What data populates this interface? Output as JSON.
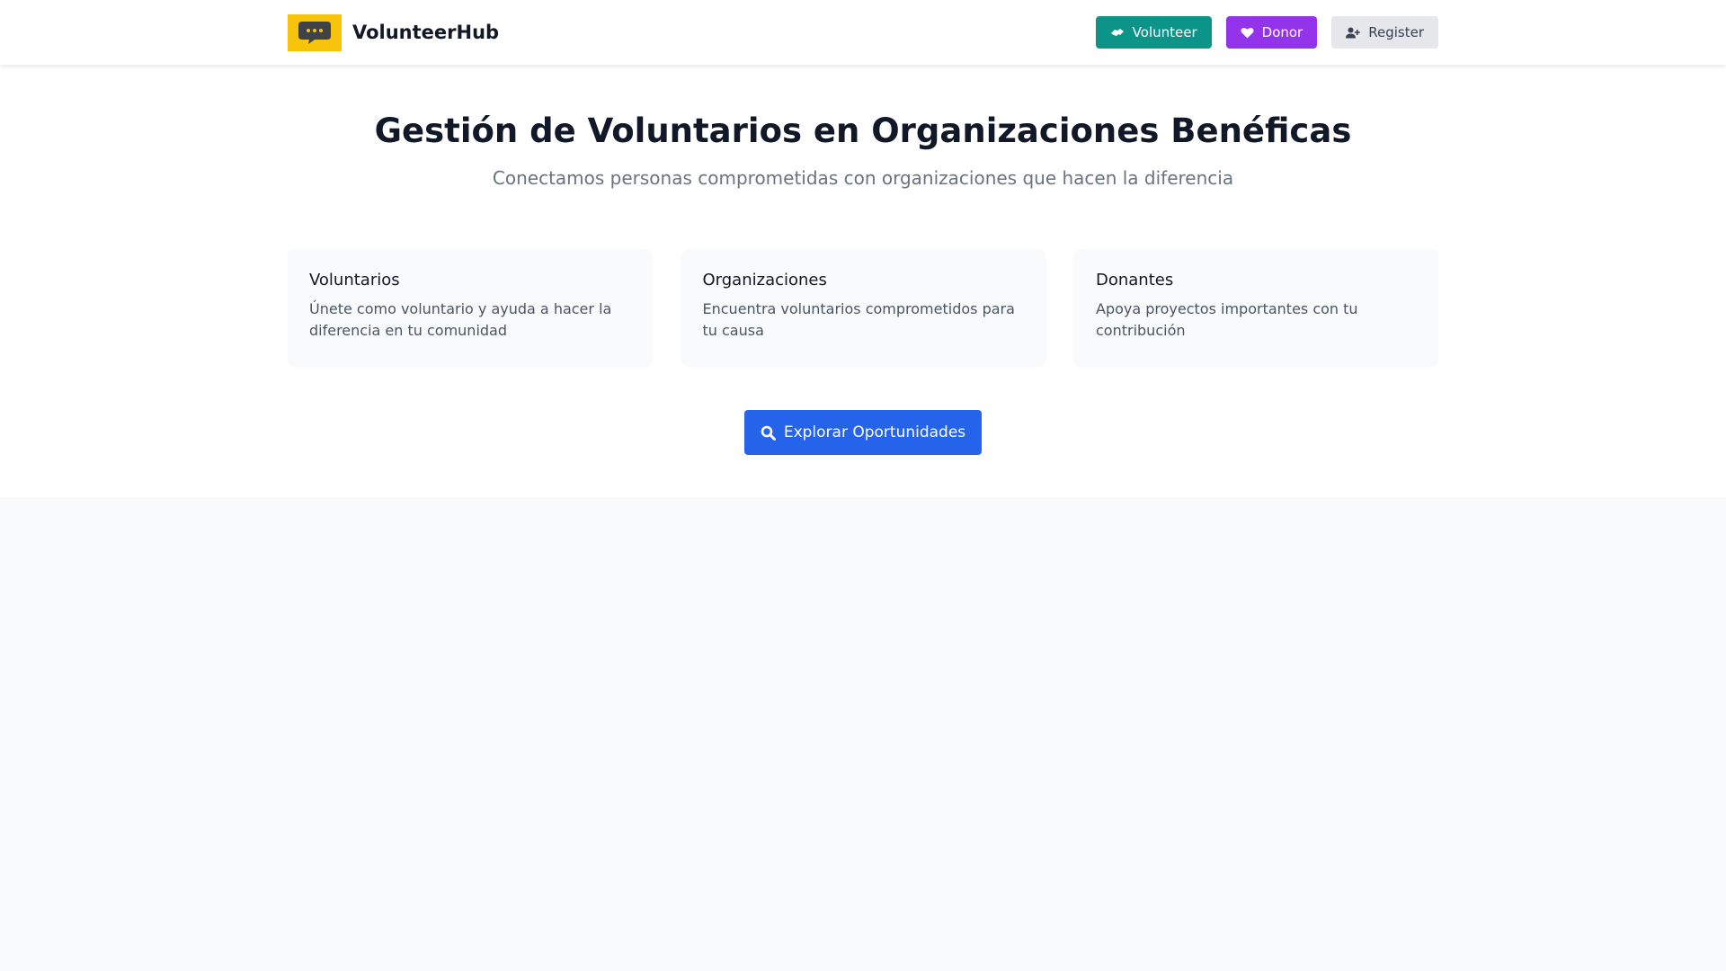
{
  "header": {
    "brand_name": "VolunteerHub",
    "logo_icon": "chat-bubble-icon",
    "nav": {
      "volunteer_label": "Volunteer",
      "donor_label": "Donor",
      "register_label": "Register"
    }
  },
  "hero": {
    "title": "Gestión de Voluntarios en Organizaciones Benéficas",
    "subtitle": "Conectamos personas comprometidas con organizaciones que hacen la diferencia",
    "cards": [
      {
        "title": "Voluntarios",
        "text": "Únete como voluntario y ayuda a hacer la diferencia en tu comunidad"
      },
      {
        "title": "Organizaciones",
        "text": "Encuentra voluntarios comprometidos para tu causa"
      },
      {
        "title": "Donantes",
        "text": "Apoya proyectos importantes con tu contribución"
      }
    ],
    "cta_label": "Explorar Oportunidades"
  },
  "colors": {
    "logo_bg": "#f8c30b",
    "volunteer": "#0d9488",
    "donor": "#9333ea",
    "register": "#e5e7eb",
    "cta": "#2563eb"
  }
}
